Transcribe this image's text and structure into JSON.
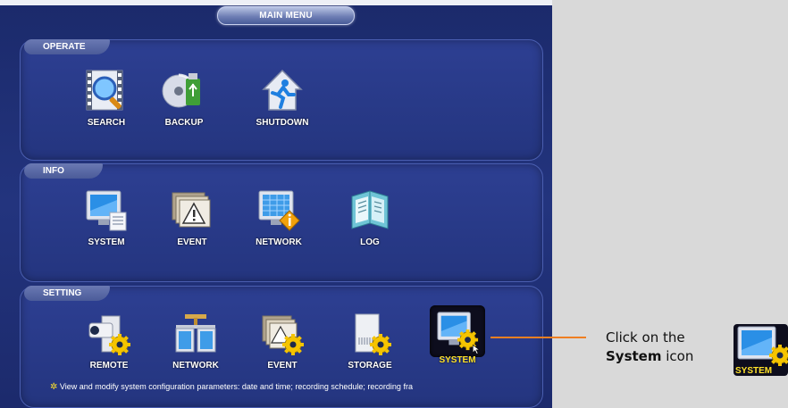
{
  "screen": {
    "title": "MAIN MENU",
    "sections": {
      "operate": {
        "label": "OPERATE",
        "items": [
          {
            "label": "SEARCH",
            "icon": "search-film-icon"
          },
          {
            "label": "BACKUP",
            "icon": "backup-disc-usb-icon"
          },
          {
            "label": "SHUTDOWN",
            "icon": "shutdown-exit-house-icon"
          }
        ]
      },
      "info": {
        "label": "INFO",
        "items": [
          {
            "label": "SYSTEM",
            "icon": "system-info-monitor-icon"
          },
          {
            "label": "EVENT",
            "icon": "event-alert-icon"
          },
          {
            "label": "NETWORK",
            "icon": "network-info-icon"
          },
          {
            "label": "LOG",
            "icon": "log-book-icon"
          }
        ]
      },
      "setting": {
        "label": "SETTING",
        "items": [
          {
            "label": "REMOTE",
            "icon": "remote-camera-gear-icon"
          },
          {
            "label": "NETWORK",
            "icon": "network-gear-icon"
          },
          {
            "label": "EVENT",
            "icon": "event-gear-icon"
          },
          {
            "label": "STORAGE",
            "icon": "storage-gear-icon"
          },
          {
            "label": "SYSTEM",
            "icon": "system-gear-icon",
            "selected": true
          }
        ]
      }
    },
    "hint": "View and modify system configuration parameters: date and time; recording schedule; recording fra"
  },
  "callout": {
    "line1": "Click on the",
    "bold": "System",
    "line2_rest": " icon",
    "icon_label": "SYSTEM"
  },
  "colors": {
    "accent_line": "#ef7f22",
    "selected_label": "#ffe22a",
    "screen_bg": "#23347e"
  }
}
